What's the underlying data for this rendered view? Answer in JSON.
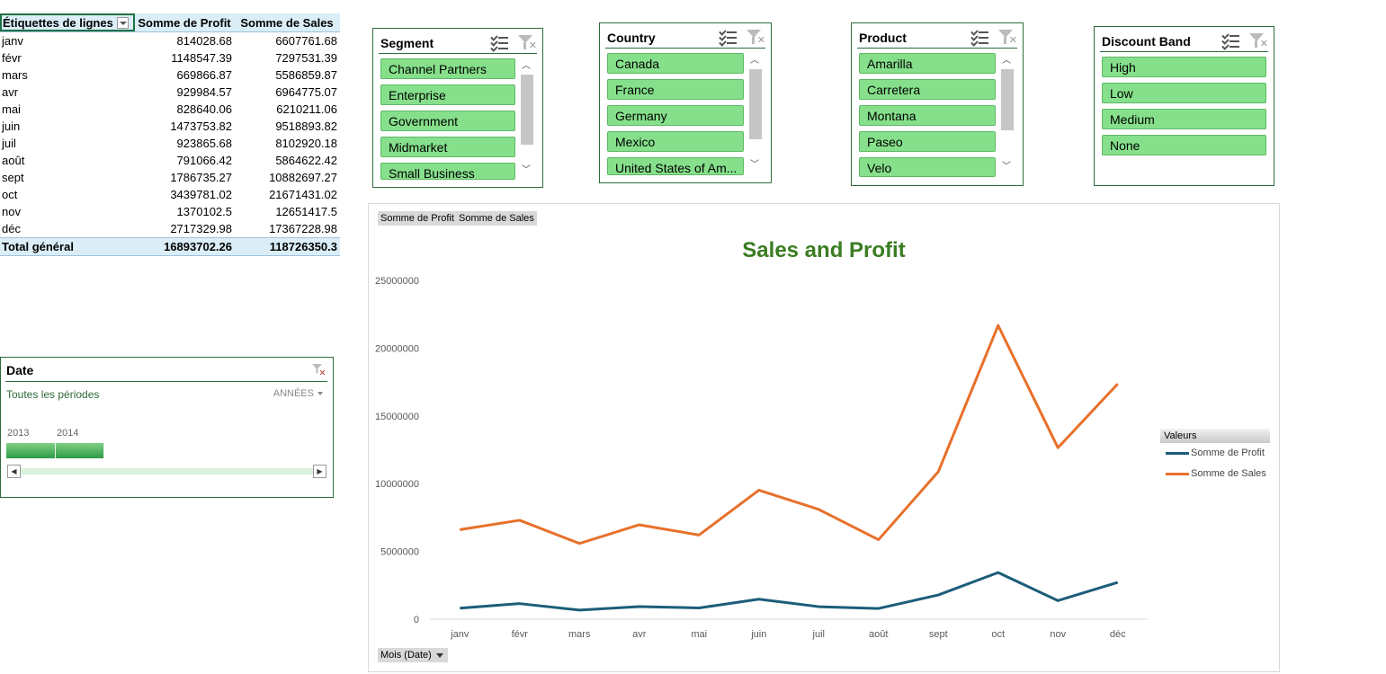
{
  "pivot": {
    "headers": {
      "rows": "Étiquettes de lignes",
      "profit": "Somme de Profit",
      "sales": "Somme de  Sales"
    },
    "rows": [
      {
        "label": "janv",
        "profit": "814028.68",
        "sales": "6607761.68"
      },
      {
        "label": "févr",
        "profit": "1148547.39",
        "sales": "7297531.39"
      },
      {
        "label": "mars",
        "profit": "669866.87",
        "sales": "5586859.87"
      },
      {
        "label": "avr",
        "profit": "929984.57",
        "sales": "6964775.07"
      },
      {
        "label": "mai",
        "profit": "828640.06",
        "sales": "6210211.06"
      },
      {
        "label": "juin",
        "profit": "1473753.82",
        "sales": "9518893.82"
      },
      {
        "label": "juil",
        "profit": "923865.68",
        "sales": "8102920.18"
      },
      {
        "label": "août",
        "profit": "791066.42",
        "sales": "5864622.42"
      },
      {
        "label": "sept",
        "profit": "1786735.27",
        "sales": "10882697.27"
      },
      {
        "label": "oct",
        "profit": "3439781.02",
        "sales": "21671431.02"
      },
      {
        "label": "nov",
        "profit": "1370102.5",
        "sales": "12651417.5"
      },
      {
        "label": "déc",
        "profit": "2717329.98",
        "sales": "17367228.98"
      }
    ],
    "total": {
      "label": "Total général",
      "profit": "16893702.26",
      "sales": "118726350.3"
    }
  },
  "slicers": {
    "segment": {
      "title": "Segment",
      "items": [
        "Channel Partners",
        "Enterprise",
        "Government",
        "Midmarket",
        "Small Business"
      ]
    },
    "country": {
      "title": "Country",
      "items": [
        "Canada",
        "France",
        "Germany",
        "Mexico",
        "United States of Am..."
      ]
    },
    "product": {
      "title": "Product",
      "items": [
        "Amarilla",
        "Carretera",
        "Montana",
        "Paseo",
        "Velo"
      ]
    },
    "discount": {
      "title": "Discount Band",
      "items": [
        "High",
        "Low",
        "Medium",
        "None"
      ]
    }
  },
  "timeline": {
    "title": "Date",
    "period": "Toutes les périodes",
    "unit": "ANNÉES",
    "years": [
      "2013",
      "2014"
    ]
  },
  "chart": {
    "field_buttons": {
      "profit": "Somme  de Profit",
      "sales": "Somme  de  Sales",
      "axis": "Mois (Date)"
    },
    "legend_title": "Valeurs",
    "colors": {
      "profit": "#1c5d7a",
      "sales": "#e8702a",
      "title": "#3a7d22"
    }
  },
  "chart_data": {
    "type": "line",
    "title": "Sales and Profit",
    "categories": [
      "janv",
      "févr",
      "mars",
      "avr",
      "mai",
      "juin",
      "juil",
      "août",
      "sept",
      "oct",
      "nov",
      "déc"
    ],
    "series": [
      {
        "name": "Somme de Profit",
        "values": [
          814028.68,
          1148547.39,
          669866.87,
          929984.57,
          828640.06,
          1473753.82,
          923865.68,
          791066.42,
          1786735.27,
          3439781.02,
          1370102.5,
          2717329.98
        ]
      },
      {
        "name": "Somme de  Sales",
        "values": [
          6607761.68,
          7297531.39,
          5586859.87,
          6964775.07,
          6210211.06,
          9518893.82,
          8102920.18,
          5864622.42,
          10882697.27,
          21671431.02,
          12651417.5,
          17367228.98
        ]
      }
    ],
    "ylim": [
      0,
      25000000
    ],
    "yticks": [
      "0",
      "5000000",
      "10000000",
      "15000000",
      "20000000",
      "25000000"
    ],
    "grid": false,
    "legend": "right"
  }
}
